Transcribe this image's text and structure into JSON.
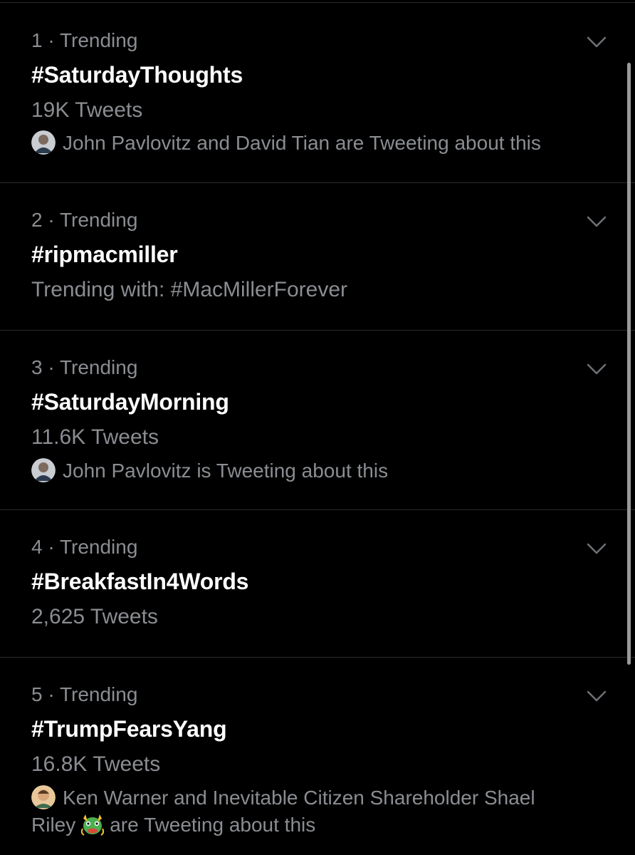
{
  "colors": {
    "background": "#000000",
    "primary_text": "#ffffff",
    "secondary_text": "#8a8d91",
    "divider": "#2a2a2a"
  },
  "trends": [
    {
      "rank_label": "1 · Trending",
      "hashtag": "#SaturdayThoughts",
      "count": "19K Tweets",
      "context": "John Pavlovitz and David Tian are Tweeting about this",
      "avatar_icon": "person-avatar"
    },
    {
      "rank_label": "2 · Trending",
      "hashtag": "#ripmacmiller",
      "trending_with": "Trending with: #MacMillerForever"
    },
    {
      "rank_label": "3 · Trending",
      "hashtag": "#SaturdayMorning",
      "count": "11.6K Tweets",
      "context": "John Pavlovitz is Tweeting about this",
      "avatar_icon": "person-avatar"
    },
    {
      "rank_label": "4 · Trending",
      "hashtag": "#BreakfastIn4Words",
      "count": "2,625 Tweets"
    },
    {
      "rank_label": "5 · Trending",
      "hashtag": "#TrumpFearsYang",
      "count": "16.8K Tweets",
      "context_part1": "Ken Warner and Inevitable Citizen Shareholder Shael",
      "context_part2": "Riley",
      "context_part3": "are Tweeting about this",
      "avatar_icon": "person-avatar",
      "emoji_icon": "dragon-face-emoji"
    }
  ]
}
